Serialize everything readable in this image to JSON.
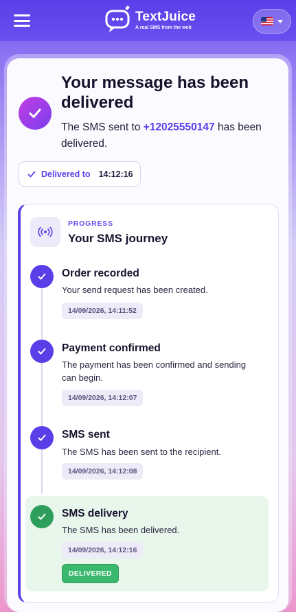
{
  "header": {
    "brand_name": "TextJuice",
    "brand_tagline": "A real SMS from the web",
    "language_flag": "us-flag-icon"
  },
  "status": {
    "title": "Your message has been delivered",
    "message_prefix": "The SMS sent to",
    "phone": "+12025550147",
    "message_suffix": "has been delivered.",
    "chip_label": "Delivered to",
    "chip_time": "14:12:16"
  },
  "progress": {
    "eyebrow": "PROGRESS",
    "title": "Your SMS journey",
    "steps": [
      {
        "title": "Order recorded",
        "description": "Your send request has been created.",
        "timestamp": "14/09/2026, 14:11:52"
      },
      {
        "title": "Payment confirmed",
        "description": "The payment has been confirmed and sending can begin.",
        "timestamp": "14/09/2026, 14:12:07"
      },
      {
        "title": "SMS sent",
        "description": "The SMS has been sent to the recipient.",
        "timestamp": "14/09/2026, 14:12:08"
      },
      {
        "title": "SMS delivery",
        "description": "The SMS has been delivered.",
        "timestamp": "14/09/2026, 14:12:16",
        "badge": "DELIVERED"
      }
    ]
  },
  "colors": {
    "accent": "#5a3ee8",
    "success": "#2e9e5c",
    "success_bg": "#e8f6ec"
  }
}
